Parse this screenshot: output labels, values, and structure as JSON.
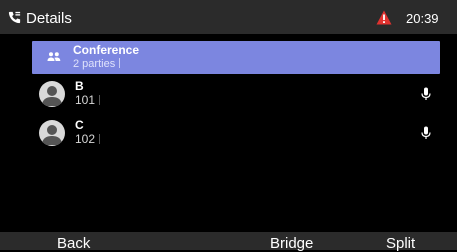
{
  "status_bar": {
    "title": "Details",
    "time": "20:39",
    "icons": {
      "phone": "phone-details-icon",
      "alert": "warning-triangle-icon"
    },
    "alert_color": "#e0322f"
  },
  "conference": {
    "name": "Conference",
    "parties_text": "2 parties",
    "icon": "group-icon",
    "highlight_color": "#7c86e0"
  },
  "parties": [
    {
      "name": "B",
      "number": "101",
      "icon": "microphone-icon"
    },
    {
      "name": "C",
      "number": "102",
      "icon": "microphone-icon"
    }
  ],
  "softkeys": {
    "back": "Back",
    "bridge": "Bridge",
    "split": "Split"
  }
}
